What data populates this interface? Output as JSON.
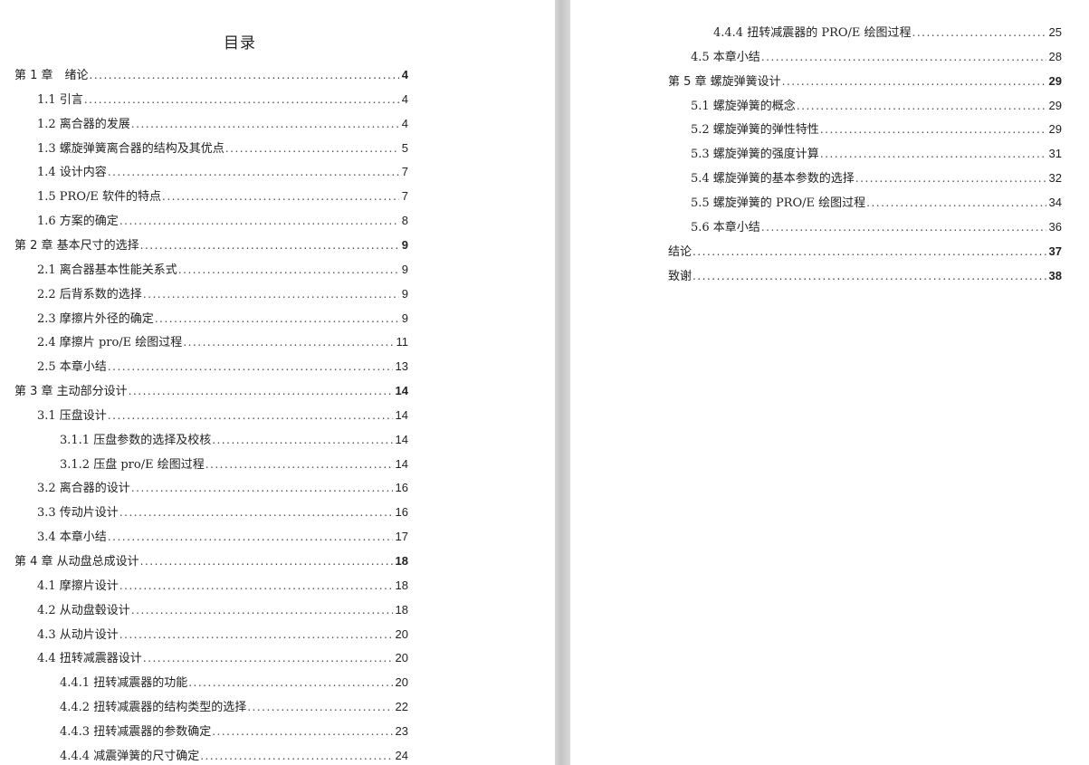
{
  "document": {
    "title": "目录",
    "left_page": [
      {
        "label": "第 1 章　绪论",
        "page": "4",
        "level": 0
      },
      {
        "label": "1.1 引言",
        "page": "4",
        "level": 1
      },
      {
        "label": "1.2 离合器的发展",
        "page": "4",
        "level": 1
      },
      {
        "label": "1.3 螺旋弹簧离合器的结构及其优点",
        "page": "5",
        "level": 1
      },
      {
        "label": "1.4 设计内容",
        "page": "7",
        "level": 1
      },
      {
        "label": "1.5 PRO/E 软件的特点",
        "page": "7",
        "level": 1
      },
      {
        "label": "1.6 方案的确定",
        "page": "8",
        "level": 1
      },
      {
        "label": "第 2 章 基本尺寸的选择",
        "page": "9",
        "level": 0
      },
      {
        "label": "2.1 离合器基本性能关系式",
        "page": "9",
        "level": 1
      },
      {
        "label": "2.2 后背系数的选择",
        "page": "9",
        "level": 1
      },
      {
        "label": "2.3 摩擦片外径的确定",
        "page": "9",
        "level": 1
      },
      {
        "label": "2.4 摩擦片 pro/E 绘图过程",
        "page": "11",
        "level": 1
      },
      {
        "label": "2.5 本章小结",
        "page": "13",
        "level": 1
      },
      {
        "label": "第 3 章 主动部分设计",
        "page": "14",
        "level": 0
      },
      {
        "label": "3.1 压盘设计",
        "page": "14",
        "level": 1
      },
      {
        "label": "3.1.1 压盘参数的选择及校核",
        "page": "14",
        "level": 2
      },
      {
        "label": "3.1.2 压盘 pro/E 绘图过程",
        "page": "14",
        "level": 2
      },
      {
        "label": "3.2 离合器的设计",
        "page": "16",
        "level": 1
      },
      {
        "label": "3.3 传动片设计",
        "page": "16",
        "level": 1
      },
      {
        "label": "3.4 本章小结",
        "page": "17",
        "level": 1
      },
      {
        "label": "第 4 章 从动盘总成设计",
        "page": "18",
        "level": 0
      },
      {
        "label": "4.1 摩擦片设计",
        "page": "18",
        "level": 1
      },
      {
        "label": "4.2 从动盘毂设计",
        "page": "18",
        "level": 1
      },
      {
        "label": "4.3 从动片设计",
        "page": "20",
        "level": 1
      },
      {
        "label": "4.4 扭转减震器设计",
        "page": "20",
        "level": 1
      },
      {
        "label": "4.4.1 扭转减震器的功能",
        "page": "20",
        "level": 2
      },
      {
        "label": "4.4.2 扭转减震器的结构类型的选择",
        "page": "22",
        "level": 2
      },
      {
        "label": "4.4.3 扭转减震器的参数确定",
        "page": "23",
        "level": 2
      },
      {
        "label": "4.4.4 减震弹簧的尺寸确定",
        "page": "24",
        "level": 2
      }
    ],
    "right_page": [
      {
        "label": "4.4.4 扭转减震器的 PRO/E 绘图过程",
        "page": "25",
        "level": 2
      },
      {
        "label": "4.5 本章小结",
        "page": "28",
        "level": 1
      },
      {
        "label": "第 5 章 螺旋弹簧设计",
        "page": "29",
        "level": 0
      },
      {
        "label": "5.1 螺旋弹簧的概念",
        "page": "29",
        "level": 1
      },
      {
        "label": "5.2 螺旋弹簧的弹性特性",
        "page": "29",
        "level": 1
      },
      {
        "label": "5.3 螺旋弹簧的强度计算",
        "page": "31",
        "level": 1
      },
      {
        "label": "5.4 螺旋弹簧的基本参数的选择",
        "page": "32",
        "level": 1
      },
      {
        "label": "5.5 螺旋弹簧的 PRO/E 绘图过程",
        "page": "34",
        "level": 1
      },
      {
        "label": "5.6 本章小结",
        "page": "36",
        "level": 1
      },
      {
        "label": "结论",
        "page": "37",
        "level": 0
      },
      {
        "label": "致谢",
        "page": "38",
        "level": 0
      }
    ]
  },
  "colors": {
    "link": "#2b3fd6",
    "page_bg": "#ffffff",
    "gutter": "#cccccc"
  }
}
